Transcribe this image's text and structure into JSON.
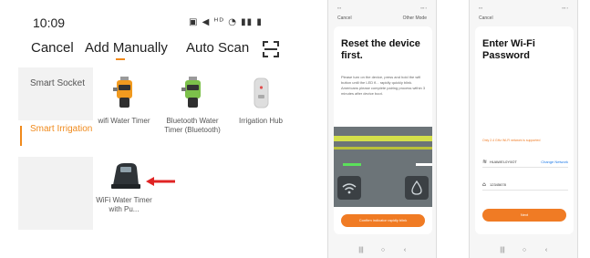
{
  "app": {
    "time": "10:09",
    "status_icons": "▣ ◀ ᴴᴰ ◔ ▮▮ ▮",
    "nav": {
      "cancel": "Cancel",
      "add_manually": "Add Manually",
      "auto_scan": "Auto Scan"
    },
    "categories": [
      {
        "label": "Smart Socket",
        "active": false
      },
      {
        "label": "Smart Irrigation",
        "active": true
      }
    ],
    "devices": [
      {
        "label": "wifi Water Timer",
        "icon": "water-timer-orange-icon"
      },
      {
        "label": "Bluetooth Water Timer (Bluetooth)",
        "icon": "water-timer-green-icon"
      },
      {
        "label": "Irrigation Hub",
        "icon": "hub-icon"
      },
      {
        "label": "WiFi Water Timer with Pu...",
        "icon": "water-timer-pump-icon"
      }
    ],
    "accent_color": "#f08a1c"
  },
  "reset_screen": {
    "top_left": "Cancel",
    "top_right": "Other Mode",
    "title": "Reset the device first.",
    "description": "Please turn on the device, press and hold the wifi button until the LED fl... rapidly quickly blink. Americans please complete pairing process within 3 minutes after device boot.",
    "button": "Confirm indicator rapidly blink"
  },
  "wifi_screen": {
    "top_left": "Cancel",
    "title": "Enter Wi-Fi Password",
    "hint": "Only 2.4 GHz Wi-Fi network is supported",
    "ssid": "HUAWEI-0Y0OT",
    "change_network": "Change Network",
    "password": "12345678",
    "button": "Next"
  }
}
